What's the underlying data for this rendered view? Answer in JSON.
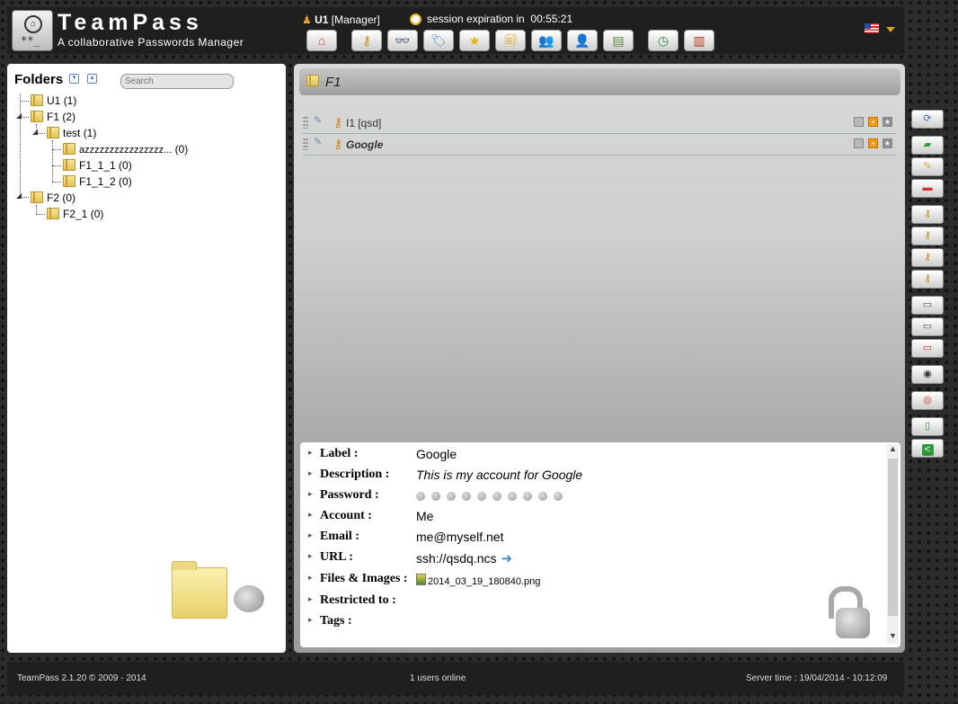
{
  "app": {
    "title": "TeamPass",
    "subtitle": "A collaborative Passwords Manager"
  },
  "user": {
    "name": "U1",
    "role": "[Manager]"
  },
  "session": {
    "label": "session expiration in",
    "time": "00:55:21"
  },
  "toolbar": {
    "buttons": [
      {
        "name": "home-button",
        "icon": "home-icon",
        "glyph": "⌂",
        "color": "#c0392b"
      },
      {
        "name": "items-button",
        "icon": "key-icon",
        "glyph": "⚷",
        "color": "#c88a12"
      },
      {
        "name": "find-button",
        "icon": "binoculars-icon",
        "glyph": "👓",
        "color": "#333333"
      },
      {
        "name": "tags-button",
        "icon": "tag-icon",
        "glyph": "🏷",
        "color": "#4a8cd1"
      },
      {
        "name": "favourites-button",
        "icon": "star-icon",
        "glyph": "★",
        "color": "#e7b400"
      },
      {
        "name": "notes-button",
        "icon": "notes-icon",
        "glyph": "🗐",
        "color": "#d8a420"
      },
      {
        "name": "roles-button",
        "icon": "users-icon",
        "glyph": "👥",
        "color": "#3f7fbf"
      },
      {
        "name": "user-button",
        "icon": "user-icon",
        "glyph": "👤",
        "color": "#3f7fbf"
      },
      {
        "name": "views-button",
        "icon": "views-icon",
        "glyph": "▤",
        "color": "#5a8a3a"
      },
      {
        "name": "history-button",
        "icon": "clock-icon",
        "glyph": "◷",
        "color": "#3a8f4a"
      },
      {
        "name": "logout-button",
        "icon": "door-icon",
        "glyph": "▥",
        "color": "#b03a20"
      }
    ]
  },
  "folders": {
    "title": "Folders",
    "search_placeholder": "Search",
    "tree": [
      {
        "label": "U1",
        "count": "(1)"
      },
      {
        "label": "F1",
        "count": "(2)"
      },
      {
        "label": "test",
        "count": "(1)"
      },
      {
        "label": "azzzzzzzzzzzzzzzz...",
        "count": "(0)"
      },
      {
        "label": "F1_1_1",
        "count": "(0)"
      },
      {
        "label": "F1_1_2",
        "count": "(0)"
      },
      {
        "label": "F2",
        "count": "(0)"
      },
      {
        "label": "F2_1",
        "count": "(0)"
      }
    ]
  },
  "main": {
    "folder_name": "F1",
    "items": [
      {
        "label": "I1 [qsd]"
      },
      {
        "label": "Google"
      }
    ]
  },
  "details": {
    "label": {
      "name": "Label :",
      "value": "Google"
    },
    "description": {
      "name": "Description :",
      "value": "This is my account for Google"
    },
    "password": {
      "name": "Password :",
      "dots": 10
    },
    "account": {
      "name": "Account :",
      "value": "Me"
    },
    "email": {
      "name": "Email :",
      "value": "me@myself.net"
    },
    "url": {
      "name": "URL :",
      "value": "ssh://qsdq.ncs"
    },
    "files": {
      "name": "Files & Images :",
      "value": "2014_03_19_180840.png"
    },
    "restricted": {
      "name": "Restricted to :",
      "value": ""
    },
    "tags": {
      "name": "Tags :",
      "value": ""
    }
  },
  "sidebar": {
    "buttons": [
      {
        "name": "refresh-button",
        "icon": "refresh-icon",
        "glyph": "⟳",
        "color": "#2a6fc9"
      },
      {
        "name": "add-folder-button",
        "icon": "add-folder-icon",
        "glyph": "▰",
        "color": "#3a9a3a"
      },
      {
        "name": "edit-folder-button",
        "icon": "edit-folder-icon",
        "glyph": "✎",
        "color": "#d8a420"
      },
      {
        "name": "delete-folder-button",
        "icon": "delete-folder-icon",
        "glyph": "▬",
        "color": "#d03030"
      },
      {
        "name": "add-item-button",
        "icon": "add-key-icon",
        "glyph": "⚷",
        "color": "#c88a12"
      },
      {
        "name": "edit-item-button",
        "icon": "edit-key-icon",
        "glyph": "⚷",
        "color": "#c88a12"
      },
      {
        "name": "delete-item-button",
        "icon": "delete-key-icon",
        "glyph": "⚷",
        "color": "#c88a12"
      },
      {
        "name": "copy-item-button",
        "icon": "copy-key-icon",
        "glyph": "⚷",
        "color": "#c88a12"
      },
      {
        "name": "copy-password-button",
        "icon": "password-field-icon",
        "glyph": "▭",
        "color": "#555555"
      },
      {
        "name": "copy-login-button",
        "icon": "login-field-icon",
        "glyph": "▭",
        "color": "#555555"
      },
      {
        "name": "copy-url-button",
        "icon": "url-field-icon",
        "glyph": "▭",
        "color": "#d03030"
      },
      {
        "name": "show-password-button",
        "icon": "eye-icon",
        "glyph": "◉",
        "color": "#333333"
      },
      {
        "name": "goto-button",
        "icon": "target-icon",
        "glyph": "◎",
        "color": "#d03030"
      },
      {
        "name": "notes-button",
        "icon": "notepad-icon",
        "glyph": "▯",
        "color": "#3a8f4a"
      },
      {
        "name": "share-button",
        "icon": "share-icon",
        "glyph": "<",
        "color": "#ffffff"
      }
    ]
  },
  "footer": {
    "version": "TeamPass 2.1.20 © 2009 - 2014",
    "users_online": "1 users online",
    "server_time": "Server time : 19/04/2014 - 10:12:09"
  }
}
